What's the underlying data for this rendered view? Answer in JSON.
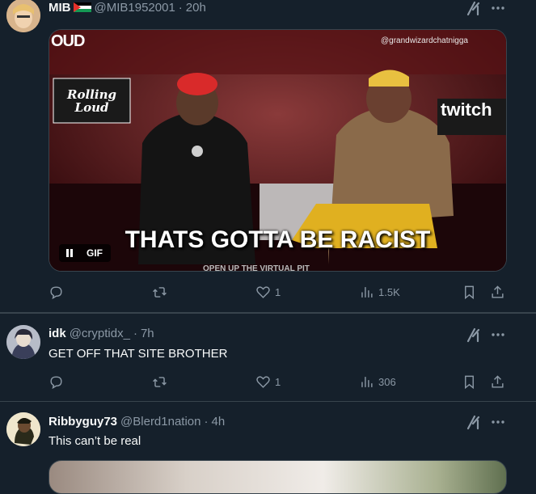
{
  "tweets": [
    {
      "name": "MIB",
      "handle": "@MIB1952001",
      "time": "20h",
      "media": {
        "watermark": "@grandwizardchatnigga",
        "caption": "THATS GOTTA BE RACIST",
        "gif_badge": "GIF",
        "banner_left": "OUD",
        "sign_rolling": "Rolling Loud",
        "sign_twitch": "twitch",
        "banner_bottom": "OPEN UP THE VIRTUAL PIT"
      },
      "replies": "",
      "retweets": "",
      "likes": "1",
      "views": "1.5K"
    },
    {
      "name": "idk",
      "handle": "@cryptidx_",
      "time": "7h",
      "text": "GET OFF THAT SITE BROTHER",
      "replies": "",
      "retweets": "",
      "likes": "1",
      "views": "306"
    },
    {
      "name": "Ribbyguy73",
      "handle": "@Blerd1nation",
      "time": "4h",
      "text": "This can’t be real"
    }
  ],
  "colors": {
    "background": "#15202b",
    "border": "#38444d",
    "muted": "#8b98a5",
    "text": "#f7f9f9"
  }
}
